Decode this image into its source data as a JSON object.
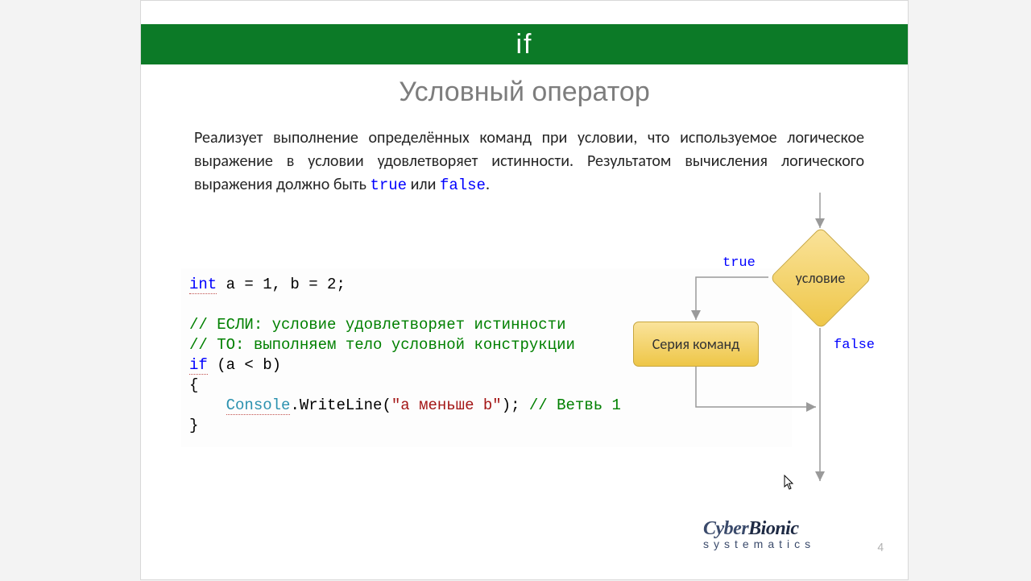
{
  "header": {
    "title": "if"
  },
  "subtitle": "Условный оператор",
  "description": {
    "text_before": "Реализует выполнение определённых команд при условии, что используемое логическое выражение в условии удовлетворяет истинности. Результатом вычисления логического выражения должно быть ",
    "true_kw": "true",
    "or_word": " или ",
    "false_kw": "false",
    "period": "."
  },
  "code": {
    "l1_kw": "int",
    "l1_rest": " a = 1, b = 2;",
    "l3": "// ЕСЛИ: условие удовлетворяет истинности",
    "l4": "// ТО: выполняем тело условной конструкции",
    "l5_kw": "if",
    "l5_rest": " (a < b)",
    "l6": "{",
    "l7_indent": "    ",
    "l7_cls": "Console",
    "l7_call": ".WriteLine(",
    "l7_str": "\"а меньше b\"",
    "l7_close": "); ",
    "l7_cmt": "// Ветвь 1",
    "l8": "}"
  },
  "diagram": {
    "diamond_label": "условие",
    "box_label": "Серия команд",
    "true_label": "true",
    "false_label": "false"
  },
  "logo": {
    "line1a": "Cyber",
    "line1b": "Bionic",
    "line2": "systematics"
  },
  "page_number": "4"
}
